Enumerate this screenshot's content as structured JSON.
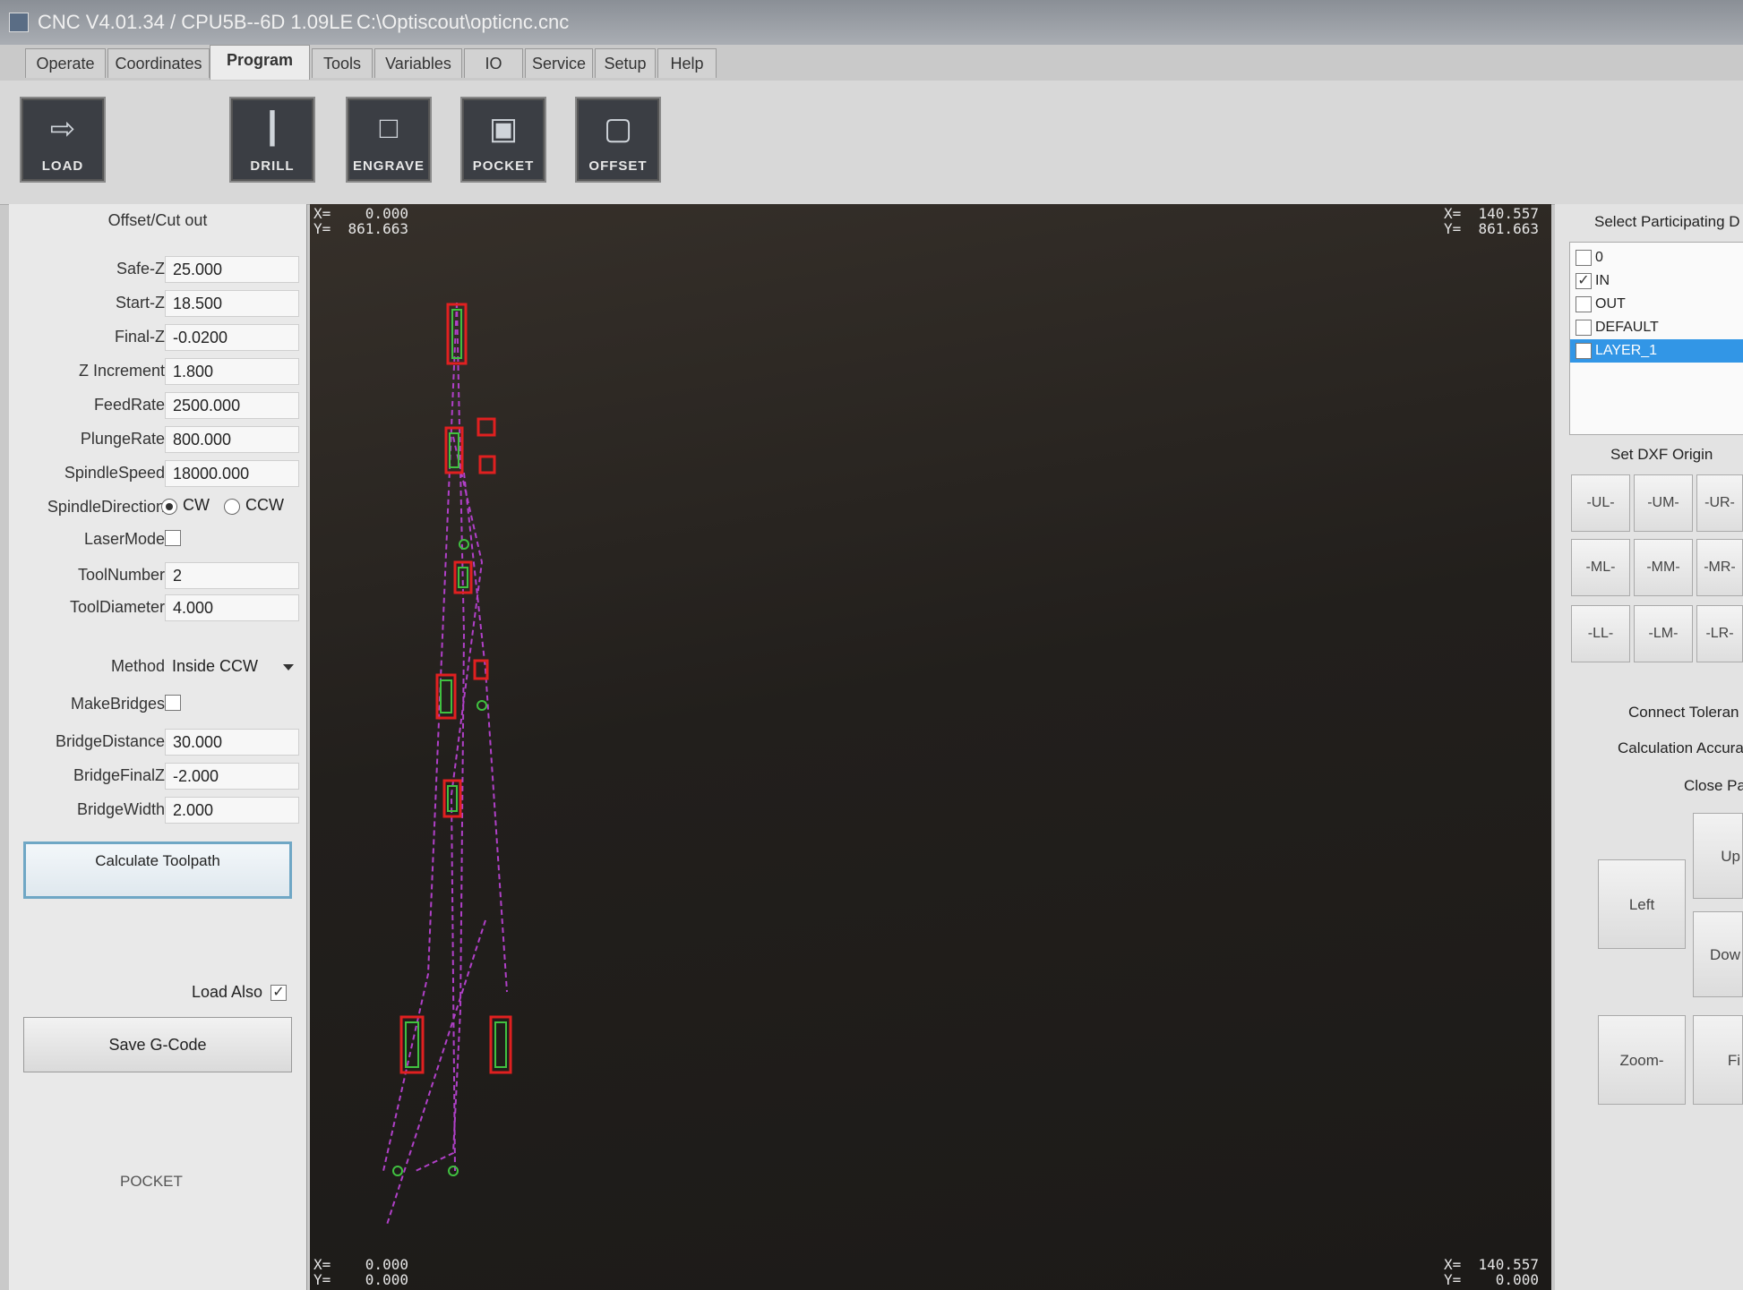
{
  "window": {
    "title": "CNC V4.01.34 / CPU5B--6D 1.09LE",
    "file_path": "C:\\Optiscout\\opticnc.cnc"
  },
  "tabs": [
    {
      "label": "Operate"
    },
    {
      "label": "Coordinates"
    },
    {
      "label": "Program",
      "active": true
    },
    {
      "label": "Tools"
    },
    {
      "label": "Variables"
    },
    {
      "label": "IO"
    },
    {
      "label": "Service"
    },
    {
      "label": "Setup"
    },
    {
      "label": "Help"
    }
  ],
  "toolbar": {
    "load": "LOAD",
    "drill": "DRILL",
    "engrave": "ENGRAVE",
    "pocket": "POCKET",
    "offset": "OFFSET"
  },
  "panel": {
    "title": "Offset/Cut out",
    "safe_z": {
      "label": "Safe-Z",
      "value": "25.000"
    },
    "start_z": {
      "label": "Start-Z",
      "value": "18.500"
    },
    "final_z": {
      "label": "Final-Z",
      "value": "-0.0200"
    },
    "z_increment": {
      "label": "Z Increment",
      "value": "1.800"
    },
    "feed_rate": {
      "label": "FeedRate",
      "value": "2500.000"
    },
    "plunge_rate": {
      "label": "PlungeRate",
      "value": "800.000"
    },
    "spindle_speed": {
      "label": "SpindleSpeed",
      "value": "18000.000"
    },
    "spindle_direction": {
      "label": "SpindleDirection",
      "cw": "CW",
      "ccw": "CCW",
      "selected": "CW"
    },
    "laser_mode": {
      "label": "LaserMode",
      "checked": false
    },
    "tool_number": {
      "label": "ToolNumber",
      "value": "2"
    },
    "tool_diameter": {
      "label": "ToolDiameter",
      "value": "4.000"
    },
    "method": {
      "label": "Method",
      "value": "Inside CCW"
    },
    "make_bridges": {
      "label": "MakeBridges",
      "checked": false
    },
    "bridge_distance": {
      "label": "BridgeDistance",
      "value": "30.000"
    },
    "bridge_final_z": {
      "label": "BridgeFinalZ",
      "value": "-2.000"
    },
    "bridge_width": {
      "label": "BridgeWidth",
      "value": "2.000"
    },
    "calculate_button": "Calculate Toolpath",
    "load_also": {
      "label": "Load Also",
      "checked": true
    },
    "save_button": "Save G-Code",
    "mode_label": "POCKET"
  },
  "viewport": {
    "top_left": {
      "x": "X=    0.000",
      "y": "Y=  861.663"
    },
    "top_right": {
      "x": "X=  140.557",
      "y": "Y=  861.663"
    },
    "bottom_left": {
      "x": "X=    0.000",
      "y": "Y=    0.000"
    },
    "bottom_right": {
      "x": "X=  140.557",
      "y": "Y=    0.000"
    },
    "colors": {
      "outline": "#e02020",
      "path": "#b040c8",
      "inner": "#40c040"
    }
  },
  "right_panel": {
    "layer_title": "Select Participating D",
    "layers": [
      {
        "name": "0",
        "checked": false,
        "selected": false
      },
      {
        "name": "IN",
        "checked": true,
        "selected": false
      },
      {
        "name": "OUT",
        "checked": false,
        "selected": false
      },
      {
        "name": "DEFAULT",
        "checked": false,
        "selected": false
      },
      {
        "name": "LAYER_1",
        "checked": false,
        "selected": true
      }
    ],
    "origin_title": "Set DXF Origin",
    "origin_buttons": [
      "-UL-",
      "-UM-",
      "-UR-",
      "-ML-",
      "-MM-",
      "-MR-",
      "-LL-",
      "-LM-",
      "-LR-"
    ],
    "connect_tolerance": "Connect Toleran",
    "calculation_accuracy": "Calculation Accura",
    "close_path": "Close Pa",
    "up": "Up",
    "left": "Left",
    "down": "Dow",
    "zoom_minus": "Zoom-",
    "fit": "Fi"
  }
}
